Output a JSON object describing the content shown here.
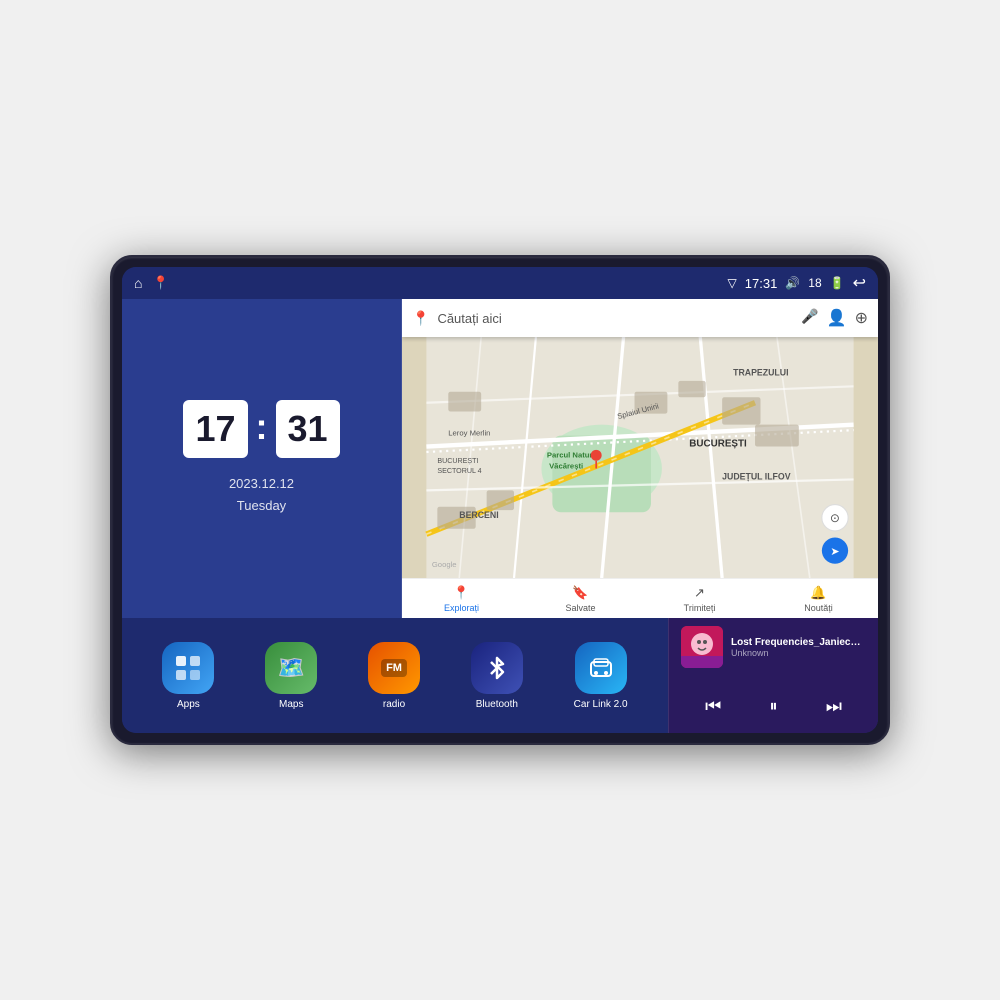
{
  "device": {
    "screen_bg": "#1e2a6e"
  },
  "status_bar": {
    "left_icons": [
      "home-icon",
      "maps-pin-icon"
    ],
    "time": "17:31",
    "signal_icon": "signal-icon",
    "volume_icon": "volume-icon",
    "volume_level": "18",
    "battery_icon": "battery-icon",
    "back_icon": "back-icon"
  },
  "clock": {
    "hours": "17",
    "minutes": "31",
    "date": "2023.12.12",
    "day": "Tuesday"
  },
  "map": {
    "search_placeholder": "Căutați aici",
    "bottom_items": [
      {
        "label": "Explorați",
        "active": true
      },
      {
        "label": "Salvate",
        "active": false
      },
      {
        "label": "Trimiteți",
        "active": false
      },
      {
        "label": "Noutăți",
        "active": false
      }
    ],
    "labels": [
      "TRAPEZULUI",
      "BUCUREȘTI",
      "JUDEȚUL ILFOV",
      "BERCENI",
      "Parcul Natural Văcărești",
      "Leroy Merlin",
      "BUCUREȘTI SECTORUL 4",
      "Splaiul Unirii",
      "Google"
    ]
  },
  "app_shortcuts": [
    {
      "id": "apps",
      "label": "Apps",
      "icon": "⊞",
      "color_class": "icon-apps"
    },
    {
      "id": "maps",
      "label": "Maps",
      "icon": "📍",
      "color_class": "icon-maps"
    },
    {
      "id": "radio",
      "label": "radio",
      "icon": "📻",
      "color_class": "icon-radio"
    },
    {
      "id": "bluetooth",
      "label": "Bluetooth",
      "icon": "⟡",
      "color_class": "icon-bluetooth"
    },
    {
      "id": "carlink",
      "label": "Car Link 2.0",
      "icon": "🚗",
      "color_class": "icon-carlink"
    }
  ],
  "music": {
    "title": "Lost Frequencies_Janieck Devy-...",
    "artist": "Unknown",
    "controls": {
      "prev": "⏮",
      "play": "⏸",
      "next": "⏭"
    }
  }
}
